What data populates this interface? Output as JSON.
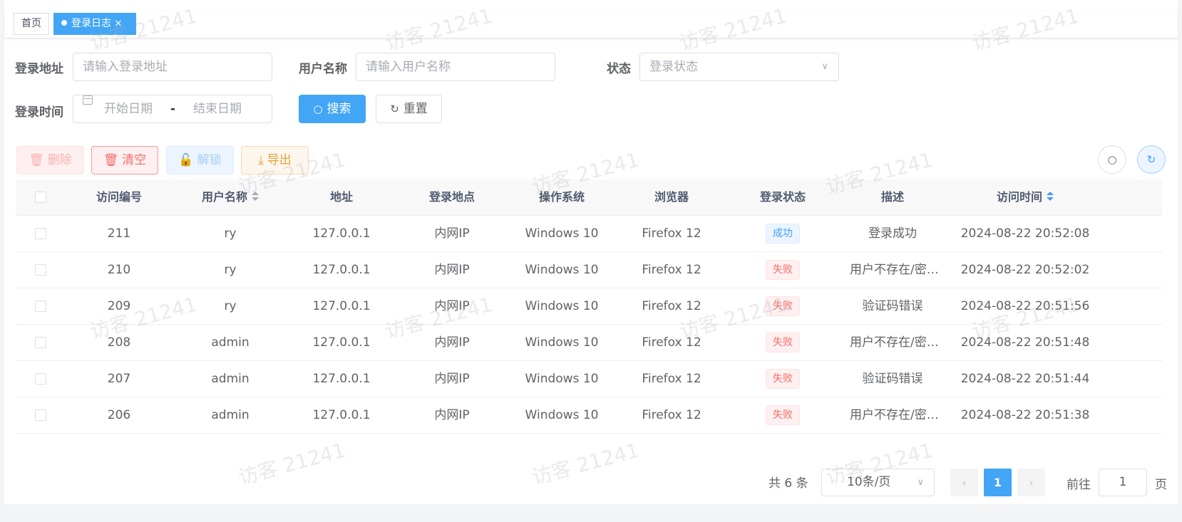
{
  "tags": {
    "home": "首页",
    "active": "登录日志",
    "close": "×"
  },
  "search": {
    "address_label": "登录地址",
    "address_placeholder": "请输入登录地址",
    "username_label": "用户名称",
    "username_placeholder": "请输入用户名称",
    "status_label": "状态",
    "status_placeholder": "登录状态",
    "time_label": "登录时间",
    "start_placeholder": "开始日期",
    "range_separator": "-",
    "end_placeholder": "结束日期",
    "search_button": "搜索",
    "reset_button": "重置"
  },
  "toolbar": {
    "delete": "删除",
    "clear": "清空",
    "unlock": "解锁",
    "export": "导出"
  },
  "table": {
    "headers": [
      "访问编号",
      "用户名称",
      "地址",
      "登录地点",
      "操作系统",
      "浏览器",
      "登录状态",
      "描述",
      "访问时间"
    ],
    "rows": [
      {
        "id": "211",
        "user": "ry",
        "ip": "127.0.0.1",
        "location": "内网IP",
        "os": "Windows 10",
        "browser": "Firefox 12",
        "status": "成功",
        "desc": "登录成功",
        "time": "2024-08-22 20:52:08"
      },
      {
        "id": "210",
        "user": "ry",
        "ip": "127.0.0.1",
        "location": "内网IP",
        "os": "Windows 10",
        "browser": "Firefox 12",
        "status": "失败",
        "desc": "用户不存在/密…",
        "time": "2024-08-22 20:52:02"
      },
      {
        "id": "209",
        "user": "ry",
        "ip": "127.0.0.1",
        "location": "内网IP",
        "os": "Windows 10",
        "browser": "Firefox 12",
        "status": "失败",
        "desc": "验证码错误",
        "time": "2024-08-22 20:51:56"
      },
      {
        "id": "208",
        "user": "admin",
        "ip": "127.0.0.1",
        "location": "内网IP",
        "os": "Windows 10",
        "browser": "Firefox 12",
        "status": "失败",
        "desc": "用户不存在/密…",
        "time": "2024-08-22 20:51:48"
      },
      {
        "id": "207",
        "user": "admin",
        "ip": "127.0.0.1",
        "location": "内网IP",
        "os": "Windows 10",
        "browser": "Firefox 12",
        "status": "失败",
        "desc": "验证码错误",
        "time": "2024-08-22 20:51:44"
      },
      {
        "id": "206",
        "user": "admin",
        "ip": "127.0.0.1",
        "location": "内网IP",
        "os": "Windows 10",
        "browser": "Firefox 12",
        "status": "失败",
        "desc": "用户不存在/密…",
        "time": "2024-08-22 20:51:38"
      }
    ]
  },
  "pagination": {
    "total": "共 6 条",
    "page_size": "10条/页",
    "current_page": "1",
    "goto_label": "前往",
    "goto_value": "1",
    "page_suffix": "页"
  },
  "watermark": "访客 21241",
  "colors": {
    "primary": "#42a5f5",
    "success_tag": "#409eff",
    "danger_tag": "#f56c6c",
    "warning": "#e6a23c"
  }
}
